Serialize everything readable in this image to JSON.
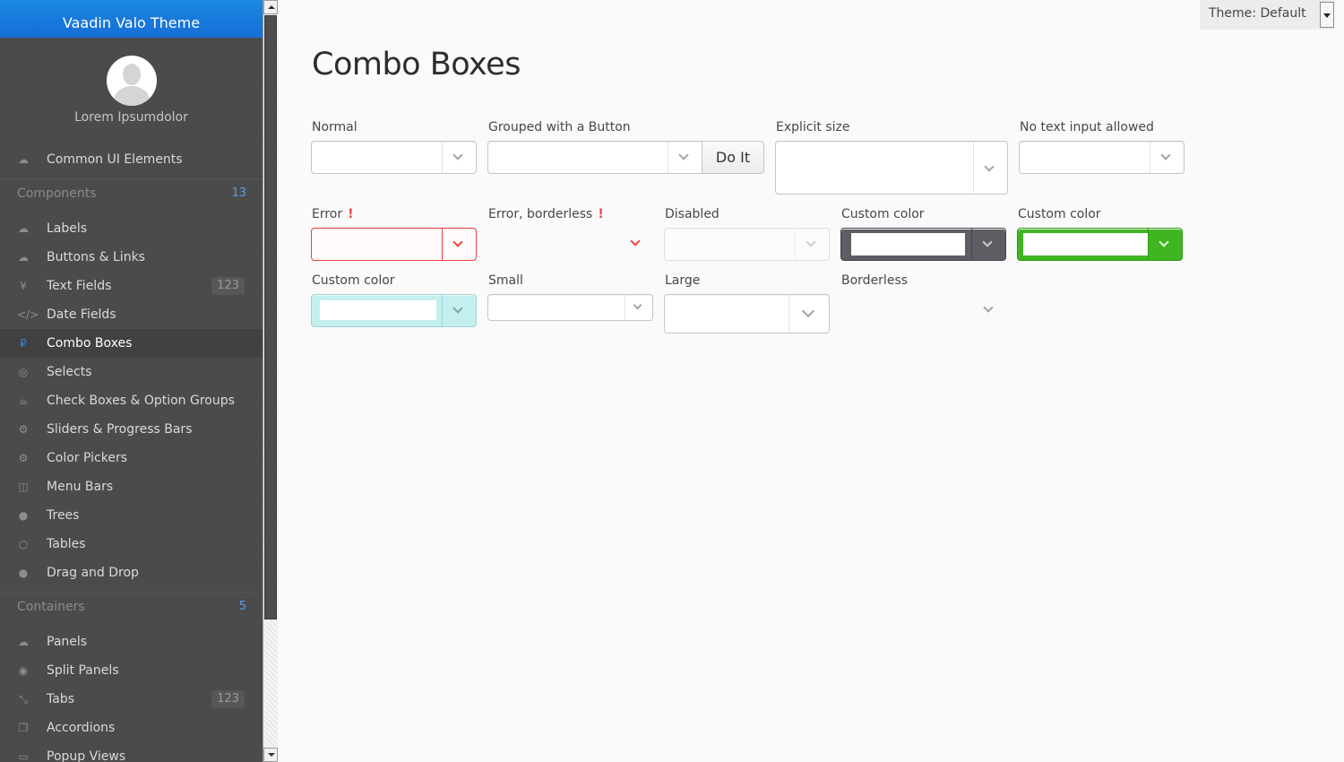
{
  "app": {
    "title": "Vaadin Valo Theme",
    "user_name": "Lorem Ipsumdolor"
  },
  "theme_select": {
    "value": "Theme: Default"
  },
  "sidebar": {
    "top_item": {
      "label": "Common UI Elements",
      "icon": "cloud-icon"
    },
    "components_section": {
      "label": "Components",
      "count": "13"
    },
    "components": [
      {
        "label": "Labels",
        "icon": "cloud-icon"
      },
      {
        "label": "Buttons & Links",
        "icon": "cloud-upload-icon"
      },
      {
        "label": "Text Fields",
        "icon": "yen-icon",
        "badge": "123"
      },
      {
        "label": "Date Fields",
        "icon": "code-icon"
      },
      {
        "label": "Combo Boxes",
        "icon": "ruble-icon",
        "active": true
      },
      {
        "label": "Selects",
        "icon": "dribbble-icon"
      },
      {
        "label": "Check Boxes & Option Groups",
        "icon": "coffee-icon"
      },
      {
        "label": "Sliders & Progress Bars",
        "icon": "gear-icon"
      },
      {
        "label": "Color Pickers",
        "icon": "gears-icon"
      },
      {
        "label": "Menu Bars",
        "icon": "columns-icon"
      },
      {
        "label": "Trees",
        "icon": "comment-icon"
      },
      {
        "label": "Tables",
        "icon": "comment-outline-icon"
      },
      {
        "label": "Drag and Drop",
        "icon": "comments-icon"
      }
    ],
    "containers_section": {
      "label": "Containers",
      "count": "5"
    },
    "containers": [
      {
        "label": "Panels",
        "icon": "cloud-icon"
      },
      {
        "label": "Split Panels",
        "icon": "compass-icon"
      },
      {
        "label": "Tabs",
        "icon": "compress-icon",
        "badge": "123"
      },
      {
        "label": "Accordions",
        "icon": "copy-icon"
      },
      {
        "label": "Popup Views",
        "icon": "credit-card-icon"
      }
    ]
  },
  "main": {
    "title": "Combo Boxes",
    "captions": {
      "normal": "Normal",
      "grouped": "Grouped with a Button",
      "explicit": "Explicit size",
      "no_text": "No text input allowed",
      "error": "Error",
      "error_borderless": "Error, borderless",
      "disabled": "Disabled",
      "custom1": "Custom color",
      "custom2": "Custom color",
      "custom3": "Custom color",
      "small": "Small",
      "large": "Large",
      "borderless": "Borderless"
    },
    "error_mark": "!",
    "do_it_label": "Do It"
  },
  "colors": {
    "accent": "#197de1",
    "error": "#ed473b",
    "custom_dark": "#5c5e63",
    "custom_green": "#3fb521",
    "custom_cyan": "#c5efef"
  }
}
